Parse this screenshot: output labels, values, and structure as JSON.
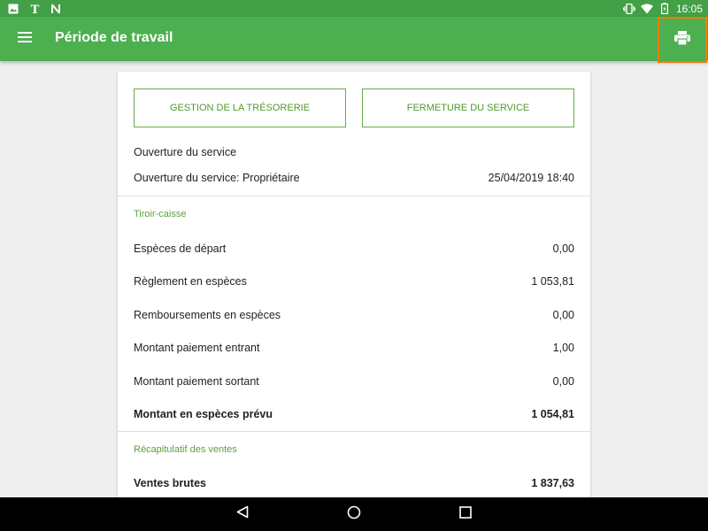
{
  "status_bar": {
    "left_icons": [
      "image-icon",
      "nyt-icon",
      "n-app-icon"
    ],
    "right_icons": [
      "vibrate-icon",
      "wifi-icon",
      "battery-icon"
    ],
    "time": "16:05"
  },
  "app_bar": {
    "title": "Période de travail",
    "menu_icon": "hamburger-menu-icon",
    "action_icon": "print-icon"
  },
  "buttons": {
    "treasury": "GESTION DE LA TRÉSORERIE",
    "close_service": "FERMETURE DU SERVICE"
  },
  "opening": {
    "heading": "Ouverture du service",
    "label": "Ouverture du service: Propriétaire",
    "value": "25/04/2019 18:40"
  },
  "cash_drawer": {
    "title": "Tiroir-caisse",
    "rows": [
      {
        "label": "Espèces de départ",
        "value": "0,00"
      },
      {
        "label": "Règlement en espèces",
        "value": "1 053,81"
      },
      {
        "label": "Remboursements en espèces",
        "value": "0,00"
      },
      {
        "label": "Montant paiement entrant",
        "value": "1,00"
      },
      {
        "label": "Montant paiement sortant",
        "value": "0,00"
      }
    ],
    "total": {
      "label": "Montant en espèces prévu",
      "value": "1 054,81"
    }
  },
  "sales_summary": {
    "title": "Récapitulatif des ventes",
    "gross": {
      "label": "Ventes brutes",
      "value": "1 837,63"
    }
  },
  "colors": {
    "status_bar": "#43a047",
    "app_bar": "#4caf50",
    "accent": "#5aa33a",
    "highlight": "#f57c00"
  }
}
